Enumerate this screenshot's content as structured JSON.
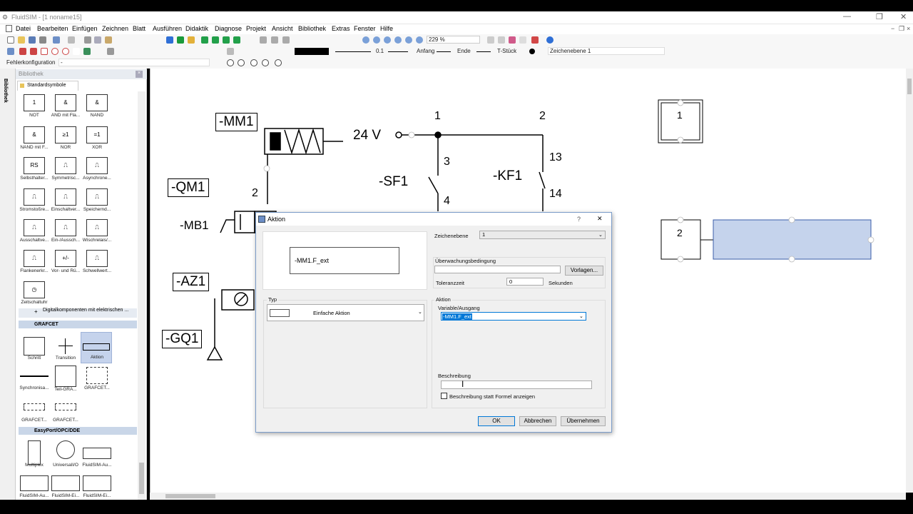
{
  "window": {
    "title": "FluidSIM - [1  noname15]",
    "minimize_glyph": "—",
    "maximize_glyph": "❐",
    "close_glyph": "✕"
  },
  "menu": [
    "Datei",
    "Bearbeiten",
    "Einfügen",
    "Zeichnen",
    "Blatt",
    "Ausführen",
    "Didaktik",
    "Diagnose",
    "Projekt",
    "Ansicht",
    "Bibliothek",
    "Extras",
    "Fenster",
    "Hilfe"
  ],
  "toolbar": {
    "zoom_value": "229 %",
    "line_width": "0.1",
    "start_label": "Anfang",
    "end_label": "Ende",
    "tpiece_label": "T-Stück",
    "layer_value": "Zeichenebene 1",
    "error_config_label": "Fehlerkonfiguration",
    "error_config_value": "-"
  },
  "library": {
    "panel_title": "Bibliothek",
    "vertical_tab": "Bibliothek",
    "tab_label": "Standardsymbole",
    "row1": [
      {
        "sym": "1",
        "label": "NOT"
      },
      {
        "sym": "&",
        "label": "AND mit Fla..."
      },
      {
        "sym": "&",
        "label": "NAND"
      }
    ],
    "row2": [
      {
        "sym": "&",
        "label": "NAND mit F..."
      },
      {
        "sym": "≥1",
        "label": "NOR"
      },
      {
        "sym": "=1",
        "label": "XOR"
      }
    ],
    "row3": [
      {
        "sym": "RS",
        "label": "Selbsthalter..."
      },
      {
        "sym": "⎍",
        "label": "Symmetrisc..."
      },
      {
        "sym": "⎍",
        "label": "Asynchrone..."
      }
    ],
    "row4": [
      {
        "sym": "⎍",
        "label": "Stromstoßre..."
      },
      {
        "sym": "⎍",
        "label": "Einschaltver..."
      },
      {
        "sym": "⎍",
        "label": "Speichernd..."
      }
    ],
    "row5": [
      {
        "sym": "⎍",
        "label": "Ausschaltve..."
      },
      {
        "sym": "⎍",
        "label": "Ein-/Aussch..."
      },
      {
        "sym": "⎍",
        "label": "Wischrelais/..."
      }
    ],
    "row6": [
      {
        "sym": "⎍",
        "label": "Flankenerkr..."
      },
      {
        "sym": "+/-",
        "label": "Vor- und Rü..."
      },
      {
        "sym": "⎍",
        "label": "Schwellwert..."
      }
    ],
    "row7": [
      {
        "sym": "◷",
        "label": "Zeitschaltuhr"
      }
    ],
    "digital_section": "Digitalkomponenten mit elektrischen ...",
    "grafcet_section": "GRAFCET",
    "grafcet_row1": [
      {
        "label": "Schritt"
      },
      {
        "label": "Transition"
      },
      {
        "label": "Aktion"
      }
    ],
    "grafcet_row2": [
      {
        "label": "Synchronisa..."
      },
      {
        "label": "Teil-GRA..."
      },
      {
        "label": "GRAFCET..."
      }
    ],
    "grafcet_row3": [
      {
        "label": "GRAFCET..."
      },
      {
        "label": "GRAFCET..."
      }
    ],
    "easyport_section": "EasyPort/OPC/DDE",
    "easyport_row1": [
      {
        "label": "Multiplex"
      },
      {
        "label": "UniversalI/O"
      },
      {
        "label": "FluidSIM-Au..."
      }
    ],
    "easyport_row2": [
      {
        "label": "FluidSIM-Au..."
      },
      {
        "label": "FluidSIM-Ei..."
      },
      {
        "label": "FluidSIM-Ei..."
      }
    ]
  },
  "canvas": {
    "labels": {
      "mm1": "-MM1",
      "qm1": "-QM1",
      "mb1": "-MB1",
      "az1": "-AZ1",
      "gq1": "-GQ1",
      "sf1": "-SF1",
      "kf1": "-KF1",
      "v24": "24 V",
      "n1": "1",
      "n2": "2",
      "n3": "3",
      "n4": "4",
      "n13": "13",
      "n14": "14",
      "n2b": "2"
    },
    "grafcet_step1": "1",
    "grafcet_step2": "2"
  },
  "dialog": {
    "title": "Aktion",
    "help": "?",
    "close": "✕",
    "preview_text": "-MM1.F_ext",
    "layer_label": "Zeichenebene",
    "layer_value": "1",
    "monitor_label": "Überwachungsbedingung",
    "monitor_value": "",
    "templates_button": "Vorlagen...",
    "tolerance_label": "Toleranzzeit",
    "tolerance_value": "0",
    "seconds_label": "Sekunden",
    "type_label": "Typ",
    "type_value": "Einfache Aktion",
    "action_label": "Aktion",
    "var_label": "Variable/Ausgang",
    "var_value": "-MM1.F_ext",
    "desc_label": "Beschreibung",
    "desc_value": "",
    "show_desc_label": "Beschreibung statt Formel anzeigen",
    "ok": "OK",
    "cancel": "Abbrechen",
    "apply": "Übernehmen"
  },
  "colors": {
    "accent": "#0078d7",
    "aktion_fill": "#c5d3ec",
    "section": "#c9d6e8"
  }
}
